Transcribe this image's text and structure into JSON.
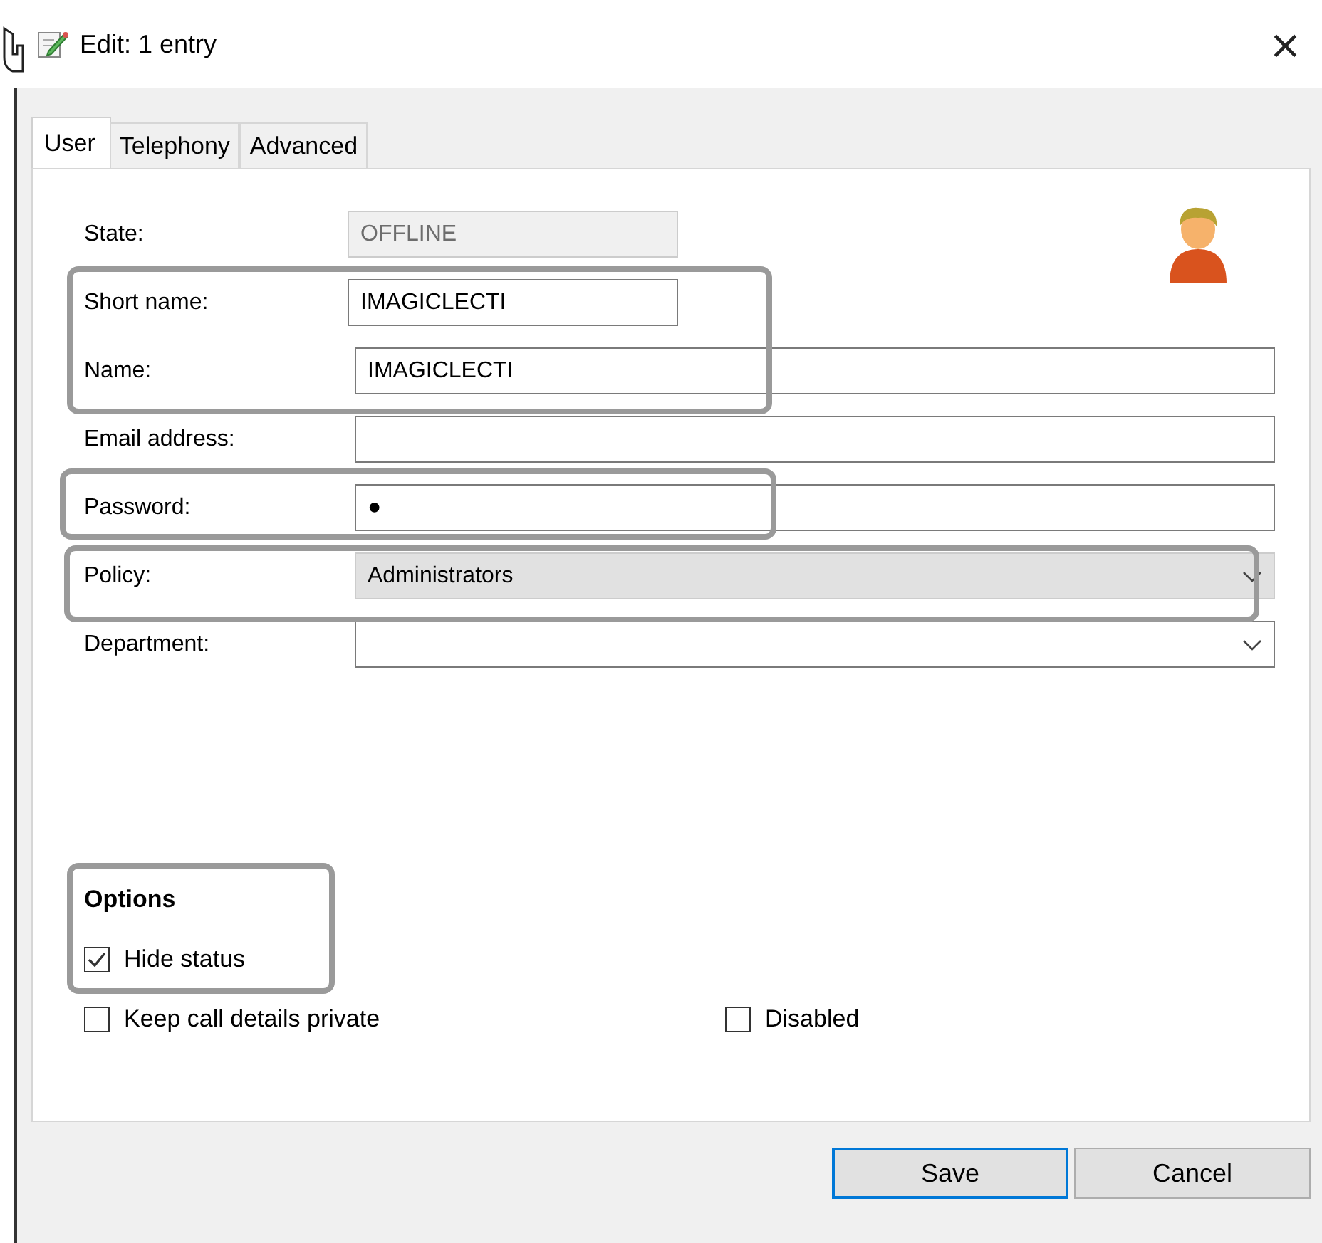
{
  "window": {
    "title": "Edit: 1 entry",
    "close": "×"
  },
  "tabs": [
    {
      "label": "User",
      "selected": true
    },
    {
      "label": "Telephony",
      "selected": false
    },
    {
      "label": "Advanced",
      "selected": false
    }
  ],
  "fields": [
    {
      "label": "State:",
      "value": "OFFLINE",
      "kind": "short",
      "disabled": true
    },
    {
      "label": "Short name:",
      "value": "IMAGICLECTI",
      "kind": "short",
      "disabled": false
    },
    {
      "label": "Name:",
      "value": "IMAGICLECTI",
      "kind": "text",
      "disabled": false
    },
    {
      "label": "Email address:",
      "kind": "text",
      "disabled": false
    },
    {
      "label": "Password:",
      "value": "●",
      "kind": "text",
      "disabled": false
    },
    {
      "label": "Policy:",
      "value": "Administrators",
      "kind": "combo",
      "disabled": true
    },
    {
      "label": "Department:",
      "kind": "combo",
      "disabled": false
    }
  ],
  "options": {
    "title": "Options",
    "items": [
      {
        "label": "Hide status",
        "checked": true
      },
      {
        "label": "Keep call details private",
        "checked": false
      },
      {
        "label": "Disabled",
        "checked": false
      }
    ]
  },
  "buttons": [
    {
      "label": "Save",
      "selected": true
    },
    {
      "label": "Cancel",
      "selected": false
    }
  ]
}
